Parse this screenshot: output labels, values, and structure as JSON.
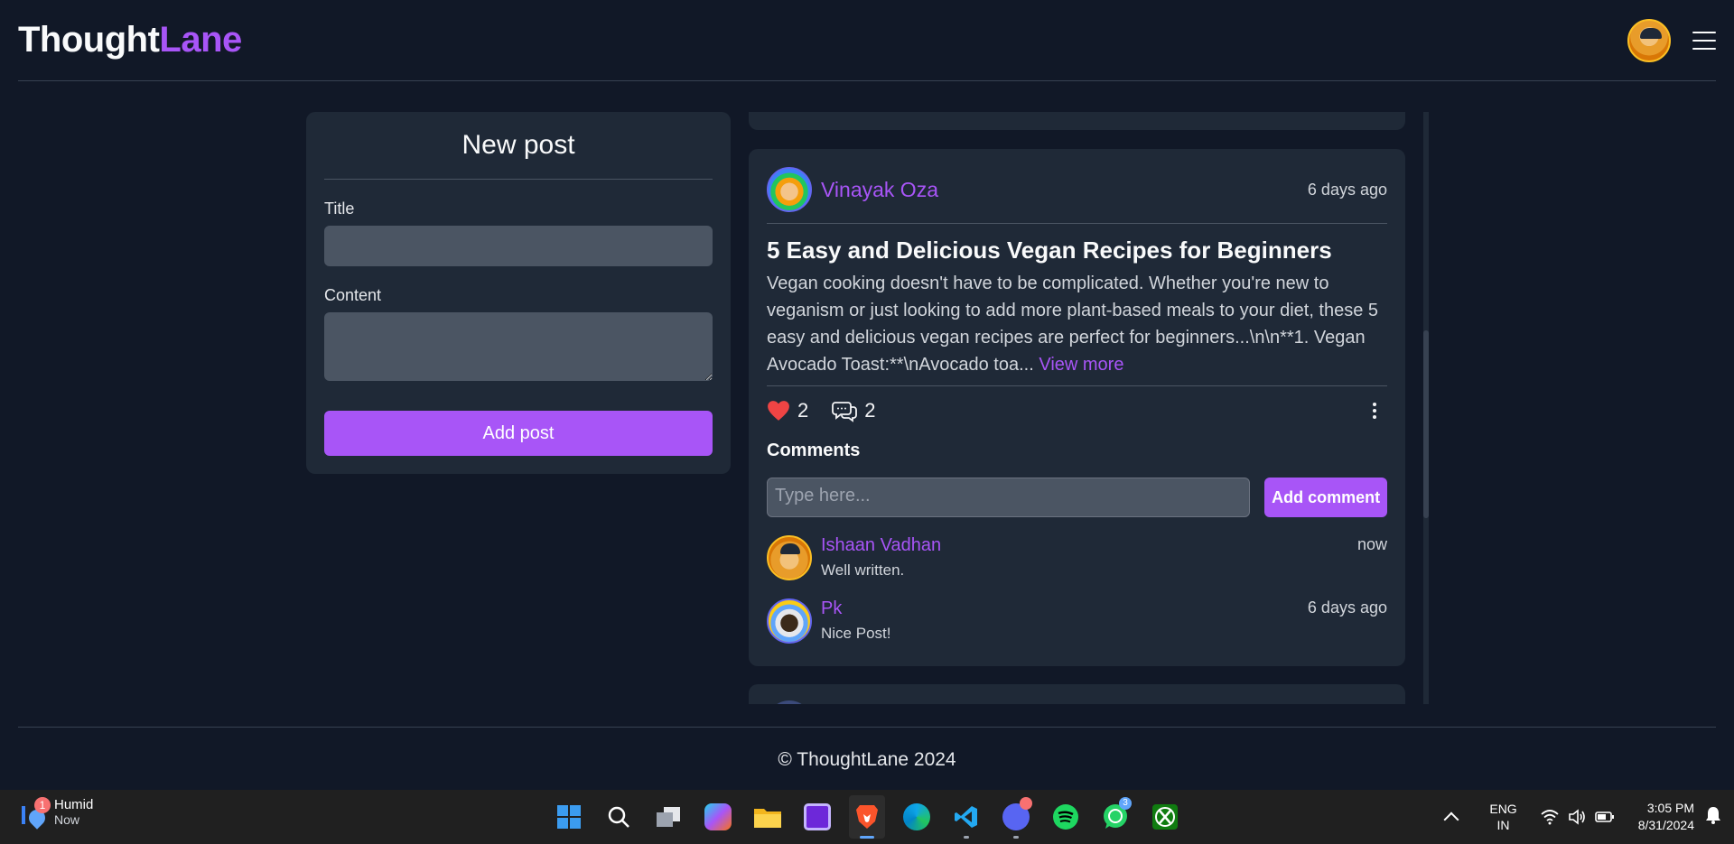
{
  "header": {
    "logo_part1": "Thought",
    "logo_part2": "Lane"
  },
  "new_post": {
    "heading": "New post",
    "title_label": "Title",
    "content_label": "Content",
    "submit_label": "Add post"
  },
  "post": {
    "author": "Vinayak Oza",
    "time": "6 days ago",
    "title": "5 Easy and Delicious Vegan Recipes for Beginners",
    "body": "Vegan cooking doesn't have to be complicated. Whether you're new to veganism or just looking to add more plant-based meals to your diet, these 5 easy and delicious vegan recipes are perfect for beginners...\\n\\n**1. Vegan Avocado Toast:**\\nAvocado toa...",
    "view_more": "View more",
    "likes": "2",
    "comments_count": "2",
    "comments_heading": "Comments",
    "comment_placeholder": "Type here...",
    "add_comment_label": "Add comment",
    "comments": [
      {
        "name": "Ishaan Vadhan",
        "text": "Well written.",
        "time": "now"
      },
      {
        "name": "Pk",
        "text": "Nice Post!",
        "time": "6 days ago"
      }
    ]
  },
  "footer": {
    "text": "© ThoughtLane 2024"
  },
  "taskbar": {
    "weather_title": "Humid",
    "weather_sub": "Now",
    "weather_badge": "1",
    "whatsapp_badge": "3",
    "lang_line1": "ENG",
    "lang_line2": "IN",
    "time": "3:05 PM",
    "date": "8/31/2024"
  },
  "colors": {
    "accent": "#a855f7",
    "background": "#111827",
    "card": "#1f2937",
    "heart": "#ef4444"
  }
}
